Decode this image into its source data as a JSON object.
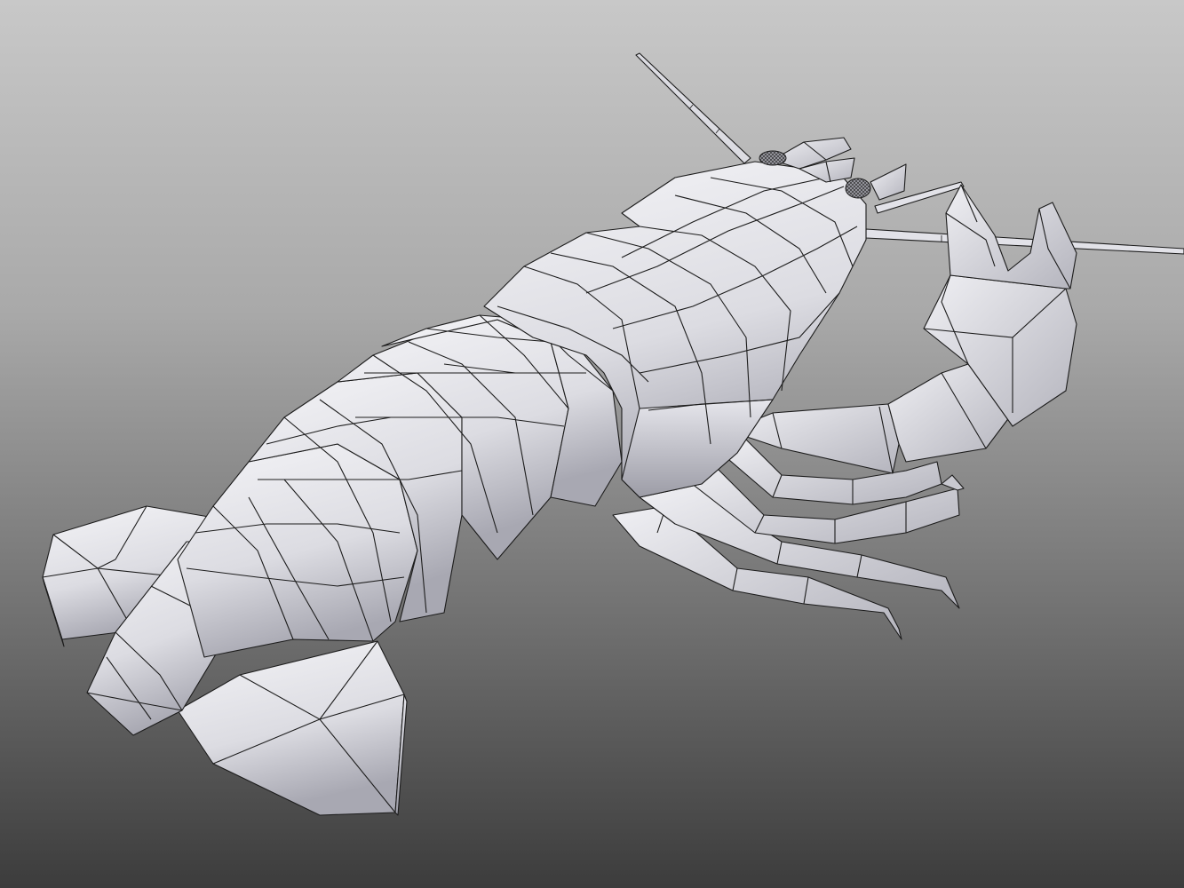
{
  "scene": {
    "subject": "crayfish-model",
    "render_mode": "shaded-wireframe",
    "colors": {
      "background_top": "#c8c8c8",
      "background_bottom": "#3c3c3c",
      "mesh_light": "#f2f2f5",
      "mesh_mid": "#d8d8de",
      "mesh_shadow": "#a9a9b2",
      "wire": "#1c1c1c"
    }
  }
}
